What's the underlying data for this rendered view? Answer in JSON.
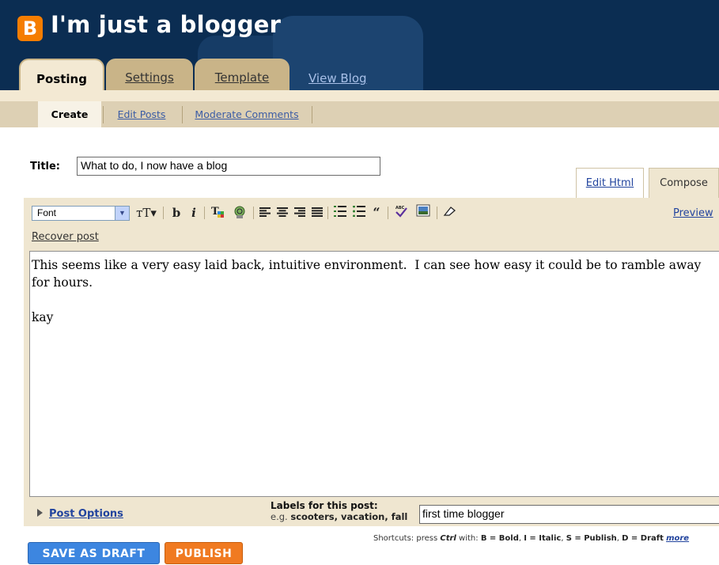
{
  "header": {
    "logo_letter": "B",
    "blog_title": "I'm just a blogger",
    "tabs": [
      {
        "label": "Posting",
        "active": true
      },
      {
        "label": "Settings"
      },
      {
        "label": "Template"
      }
    ],
    "view_blog": "View Blog"
  },
  "subnav": {
    "items": [
      {
        "label": "Create",
        "active": true
      },
      {
        "label": "Edit Posts"
      },
      {
        "label": "Moderate Comments"
      }
    ]
  },
  "post": {
    "title_label": "Title:",
    "title_value": "What to do, I now have a blog",
    "body": "This seems like a very easy laid back, intuitive environment.  I can see how easy it could be to ramble away for hours.\n\nkay"
  },
  "editor": {
    "mode_tabs": [
      "Edit Html",
      "Compose"
    ],
    "font_select": "Font",
    "preview": "Preview",
    "recover": "Recover post",
    "toolbar_icons": [
      "font-size-icon",
      "bold-icon",
      "italic-icon",
      "text-color-icon",
      "link-icon",
      "align-left-icon",
      "align-center-icon",
      "align-right-icon",
      "justify-icon",
      "numbered-list-icon",
      "bulleted-list-icon",
      "blockquote-icon",
      "spellcheck-icon",
      "image-icon",
      "remove-formatting-icon"
    ]
  },
  "options": {
    "post_options": "Post Options",
    "labels_title": "Labels for this post:",
    "labels_eg_prefix": "e.g.",
    "labels_eg": "scooters, vacation, fall",
    "labels_value": "first time blogger"
  },
  "shortcuts": {
    "text": "Shortcuts: press",
    "ctrl": "Ctrl",
    "with": "with:",
    "b": "B = Bold",
    "i": "I = Italic",
    "s": "S = Publish",
    "d": "D = Draft",
    "more": "more"
  },
  "buttons": {
    "save_draft": "SAVE AS DRAFT",
    "publish": "PUBLISH"
  },
  "colors": {
    "header_bg": "#0b2d52",
    "logo": "#f57d00",
    "save_button": "#3d86e0",
    "publish_button": "#f07a21",
    "link": "#22449e"
  }
}
